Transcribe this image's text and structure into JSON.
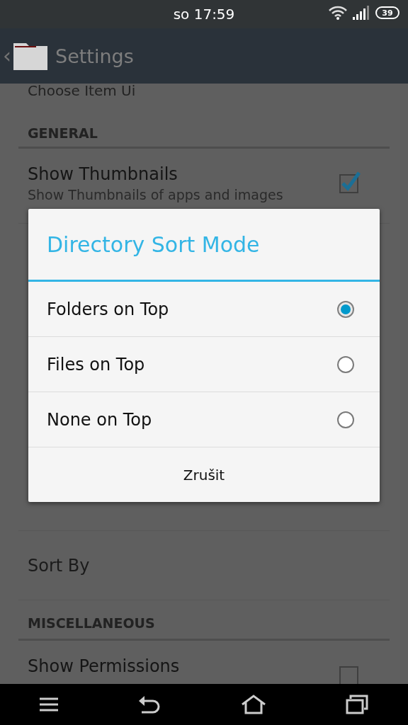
{
  "status_bar": {
    "time": "so 17:59",
    "battery": "39"
  },
  "action_bar": {
    "back": "‹",
    "title": "Settings"
  },
  "settings": [
    {
      "kind": "item",
      "title": "Choose Item Ui"
    },
    {
      "kind": "header",
      "title": "GENERAL"
    },
    {
      "kind": "check",
      "title": "Show Thumbnails",
      "summary": "Show Thumbnails of apps and images",
      "checked": true
    },
    {
      "kind": "hidden"
    },
    {
      "kind": "item",
      "title": "Sort By"
    },
    {
      "kind": "header",
      "title": "MISCELLANEOUS"
    },
    {
      "kind": "check",
      "title": "Show Permissions",
      "checked": false
    }
  ],
  "dialog": {
    "title": "Directory Sort Mode",
    "options": [
      {
        "label": "Folders on Top",
        "selected": true
      },
      {
        "label": "Files on Top",
        "selected": false
      },
      {
        "label": "None on Top",
        "selected": false
      }
    ],
    "cancel": "Zrušit"
  }
}
